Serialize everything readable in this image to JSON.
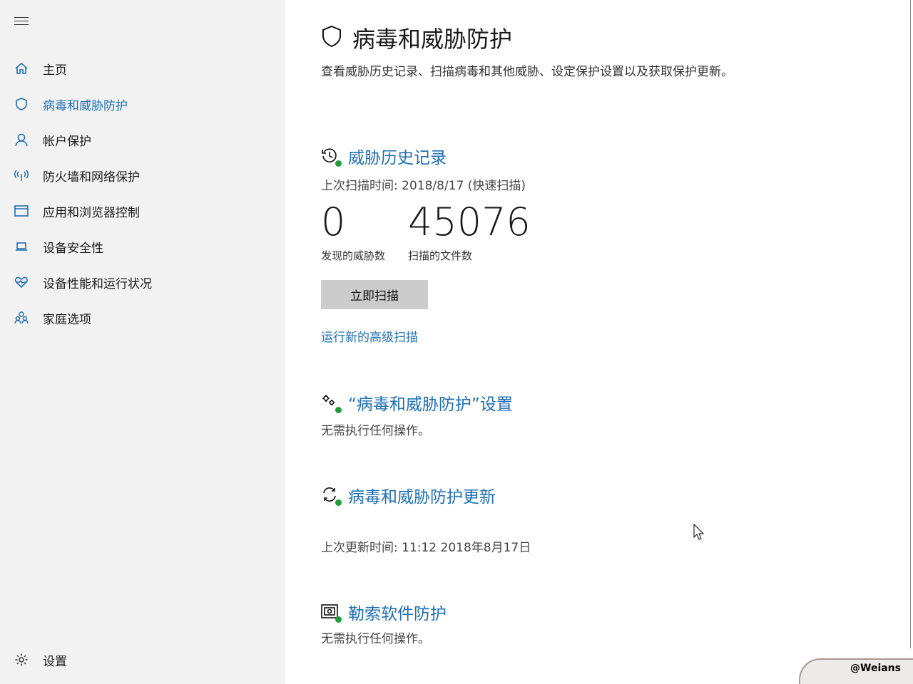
{
  "sidebar": {
    "items": [
      {
        "label": "主页",
        "icon": "home-icon"
      },
      {
        "label": "病毒和威胁防护",
        "icon": "shield-icon",
        "active": true
      },
      {
        "label": "帐户保护",
        "icon": "person-icon"
      },
      {
        "label": "防火墙和网络保护",
        "icon": "wireless-icon"
      },
      {
        "label": "应用和浏览器控制",
        "icon": "browser-window-icon"
      },
      {
        "label": "设备安全性",
        "icon": "laptop-icon"
      },
      {
        "label": "设备性能和运行状况",
        "icon": "heart-icon"
      },
      {
        "label": "家庭选项",
        "icon": "family-icon"
      }
    ],
    "settings": "设置"
  },
  "main": {
    "title": "病毒和威胁防护",
    "description": "查看威胁历史记录、扫描病毒和其他威胁、设定保护设置以及获取保护更新。",
    "history": {
      "heading": "威胁历史记录",
      "last_scan": "上次扫描时间: 2018/8/17 (快速扫描)",
      "threats_count": "0",
      "threats_label": "发现的威胁数",
      "files_count": "45076",
      "files_label": "扫描的文件数",
      "scan_button": "立即扫描",
      "advanced_link": "运行新的高级扫描"
    },
    "settings": {
      "heading": "“病毒和威胁防护”设置",
      "status": "无需执行任何操作。"
    },
    "updates": {
      "heading": "病毒和威胁防护更新",
      "last_update": "上次更新时间: 11:12 2018年8月17日"
    },
    "ransomware": {
      "heading": "勒索软件防护",
      "status": "无需执行任何操作。"
    }
  },
  "watermark": "@Weians",
  "colors": {
    "accent": "#1f6fb5",
    "sidebar_bg": "#f2f2f2",
    "ok": "#1f9d3a"
  }
}
